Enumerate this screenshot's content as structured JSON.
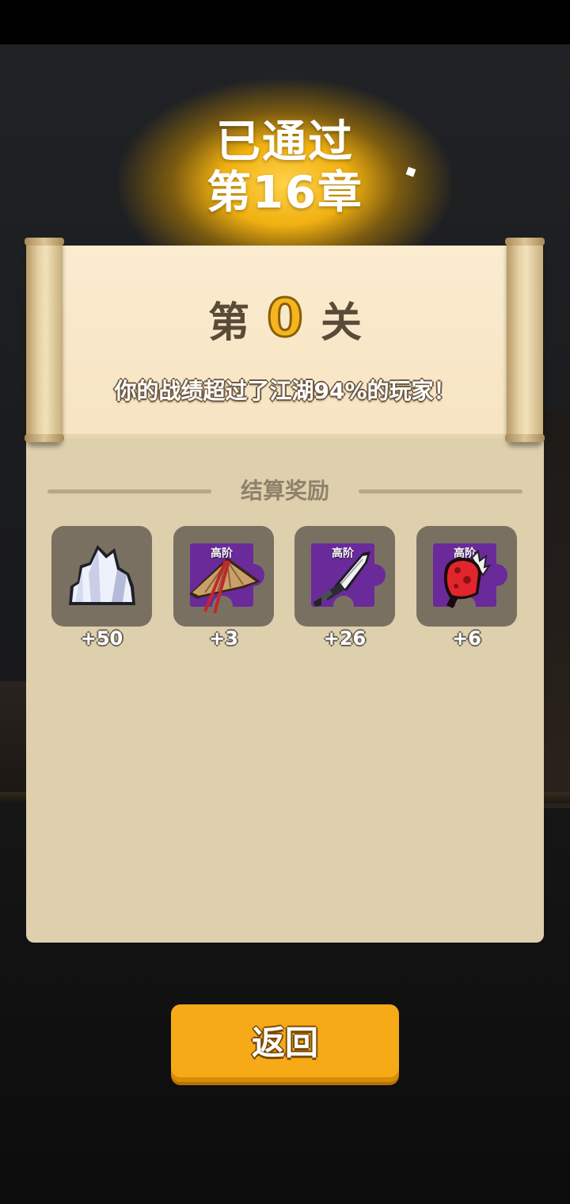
{
  "header": {
    "status_line": "已通过",
    "chapter": "第16章"
  },
  "scroll": {
    "level_prefix": "第",
    "level_number": "0",
    "level_suffix": "关",
    "rank_message": "你的战绩超过了江湖94%的玩家！"
  },
  "rewards": {
    "title": "结算奖励",
    "items": [
      {
        "icon": "crystal-icon",
        "badge": "",
        "count": "+50"
      },
      {
        "icon": "bamboo-hat-icon",
        "badge": "高阶",
        "count": "+3"
      },
      {
        "icon": "saber-icon",
        "badge": "高阶",
        "count": "+26"
      },
      {
        "icon": "red-gauntlet-icon",
        "badge": "高阶",
        "count": "+6"
      }
    ]
  },
  "actions": {
    "back_label": "返回"
  },
  "colors": {
    "accent": "#f6aa18",
    "panel": "#decfad",
    "scroll": "#fbecd0",
    "rank_number": "#f6b51c",
    "piece_purple": "#6a2a9a"
  }
}
